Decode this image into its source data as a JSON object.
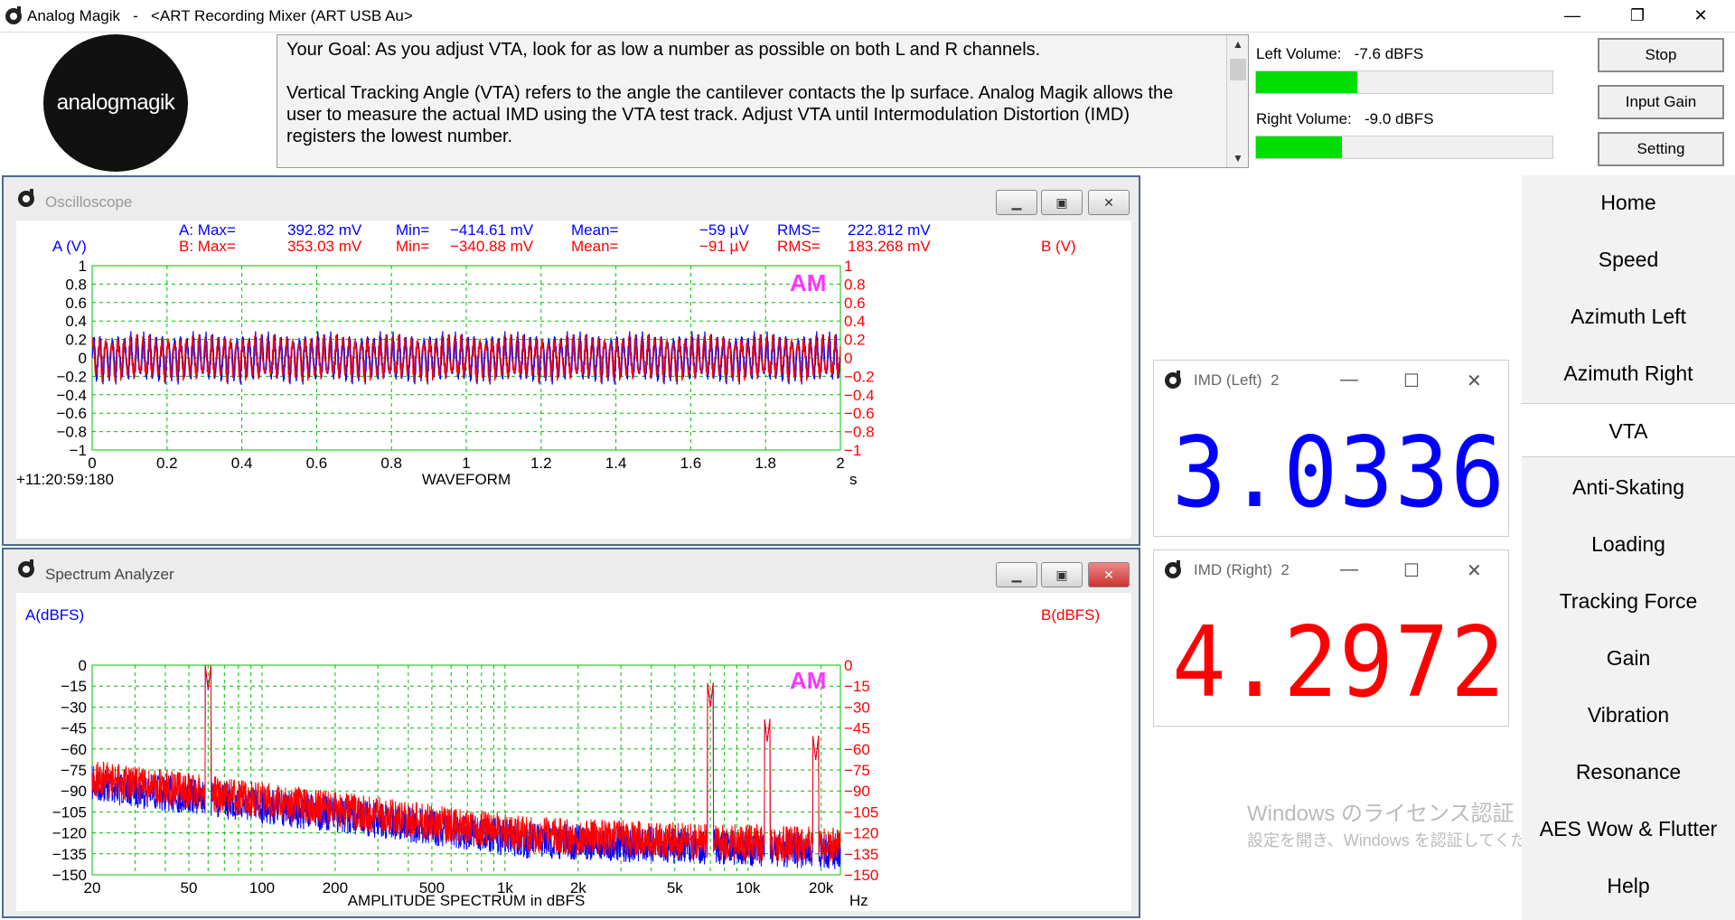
{
  "window": {
    "title": "Analog Magik   -   <ART Recording Mixer (ART USB Au>",
    "controls": {
      "minimize": "—",
      "restore": "❐",
      "close": "✕"
    }
  },
  "logo": {
    "text": "analogmagik"
  },
  "goal": {
    "line1": "Your Goal: As you adjust VTA, look for as low a number as possible on both L and R channels.",
    "line2": "Vertical Tracking Angle (VTA) refers to the angle the cantilever contacts the lp surface.   Analog Magik allows the user to measure the actual IMD using the VTA test track.  Adjust VTA until Intermodulation Distortion (IMD) registers the lowest number."
  },
  "volume": {
    "left_label": "Left Volume:   -7.6 dBFS",
    "right_label": "Right Volume:   -9.0 dBFS",
    "left_level": 0.34,
    "right_level": 0.29,
    "bar_color": "#00dd00"
  },
  "buttons": {
    "stop": "Stop",
    "input_gain": "Input Gain",
    "setting": "Setting"
  },
  "oscilloscope": {
    "title": "Oscilloscope",
    "stats": {
      "a_label": "A: Max=",
      "a_max": "392.82 mV",
      "a_min_label": "Min=",
      "a_min": "−414.61 mV",
      "a_mean_label": "Mean=",
      "a_mean": "−59  µV",
      "a_rms_label": "RMS=",
      "a_rms": "222.812 mV",
      "b_label": "B: Max=",
      "b_max": "353.03 mV",
      "b_min_label": "Min=",
      "b_min": "−340.88 mV",
      "b_mean_label": "Mean=",
      "b_mean": "−91  µV",
      "b_rms_label": "RMS=",
      "b_rms": "183.268 mV"
    },
    "left_axis": "A (V)",
    "right_axis": "B (V)",
    "timestamp": "+11:20:59:180",
    "xlabel": "WAVEFORM",
    "xunit": "s",
    "badge": "AM"
  },
  "spectrum": {
    "title": "Spectrum Analyzer",
    "left_axis": "A(dBFS)",
    "right_axis": "B(dBFS)",
    "xlabel": "AMPLITUDE SPECTRUM in dBFS",
    "xunit": "Hz",
    "badge": "AM"
  },
  "imd_left": {
    "title": "IMD (Left)  2",
    "value": "3.0336 %",
    "color": "#0000ff"
  },
  "imd_right": {
    "title": "IMD (Right)  2",
    "value": "4.2972 %",
    "color": "#ff0000"
  },
  "dsp_controls": {
    "min": "—",
    "max": "☐",
    "close": "✕"
  },
  "nav": [
    "Home",
    "Speed",
    "Azimuth Left",
    "Azimuth Right",
    "VTA",
    "Anti-Skating",
    "Loading",
    "Tracking Force",
    "Gain",
    "Vibration",
    "Resonance",
    "AES Wow & Flutter",
    "Help"
  ],
  "nav_active": "VTA",
  "watermark": {
    "line1": "Windows のライセンス認証",
    "line2": "設定を開き、Windows を認証してください。"
  },
  "chart_data": [
    {
      "type": "line",
      "title": "WAVEFORM",
      "xlabel": "s",
      "ylabel": "A (V)",
      "y2label": "B (V)",
      "xlim": [
        0,
        2
      ],
      "ylim": [
        -1,
        1
      ],
      "x_ticks": [
        "0",
        "0.2",
        "0.4",
        "0.6",
        "0.8",
        "1",
        "1.2",
        "1.4",
        "1.6",
        "1.8",
        "2"
      ],
      "y_ticks": [
        "1",
        "0.8",
        "0.6",
        "0.4",
        "0.2",
        "0",
        "−0.2",
        "−0.4",
        "−0.6",
        "−0.8",
        "−1"
      ],
      "y2_ticks": [
        "1",
        "0.8",
        "0.6",
        "0.4",
        "0.2",
        "0",
        "−0.2",
        "−0.4",
        "−0.6",
        "−0.8",
        "−1"
      ],
      "grid": true,
      "series": [
        {
          "name": "A",
          "color": "#0000ff",
          "amplitude": 0.2,
          "peak_max": 0.39,
          "peak_min": -0.41,
          "cycles": 120
        },
        {
          "name": "B",
          "color": "#ff0000",
          "amplitude": 0.18,
          "peak_max": 0.35,
          "peak_min": -0.34,
          "cycles": 120
        }
      ]
    },
    {
      "type": "line",
      "title": "AMPLITUDE SPECTRUM in dBFS",
      "xlabel": "Hz",
      "ylabel": "A(dBFS)",
      "y2label": "B(dBFS)",
      "xscale": "log",
      "xlim": [
        20,
        24000
      ],
      "ylim": [
        -150,
        0
      ],
      "x_ticks": [
        {
          "v": 20,
          "t": "20"
        },
        {
          "v": 50,
          "t": "50"
        },
        {
          "v": 100,
          "t": "100"
        },
        {
          "v": 200,
          "t": "200"
        },
        {
          "v": 500,
          "t": "500"
        },
        {
          "v": 1000,
          "t": "1k"
        },
        {
          "v": 2000,
          "t": "2k"
        },
        {
          "v": 5000,
          "t": "5k"
        },
        {
          "v": 10000,
          "t": "10k"
        },
        {
          "v": 20000,
          "t": "20k"
        }
      ],
      "y_ticks": [
        "0",
        "−15",
        "−30",
        "−45",
        "−60",
        "−75",
        "−90",
        "−105",
        "−120",
        "−135",
        "−150"
      ],
      "y2_ticks": [
        "0",
        "−15",
        "−30",
        "−45",
        "−60",
        "−75",
        "−90",
        "−105",
        "−120",
        "−135",
        "−150"
      ],
      "grid": true,
      "series": [
        {
          "name": "A",
          "color": "#0000ff",
          "peaks": [
            {
              "f": 60,
              "db": -18
            },
            {
              "f": 7000,
              "db": -30
            },
            {
              "f": 12000,
              "db": -55
            },
            {
              "f": 19000,
              "db": -68
            }
          ]
        },
        {
          "name": "B",
          "color": "#ff0000",
          "peaks": [
            {
              "f": 60,
              "db": -17
            },
            {
              "f": 7000,
              "db": -30
            },
            {
              "f": 12000,
              "db": -55
            },
            {
              "f": 19000,
              "db": -68
            }
          ]
        }
      ]
    }
  ]
}
